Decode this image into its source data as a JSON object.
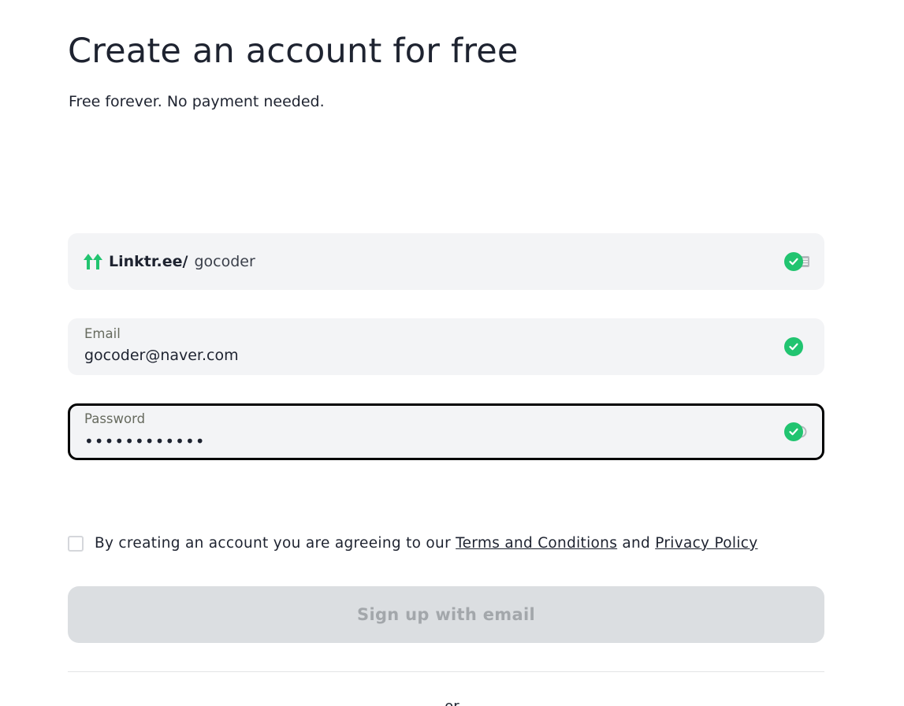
{
  "header": {
    "title": "Create an account for free",
    "subtitle": "Free forever. No payment needed."
  },
  "form": {
    "username": {
      "prefix": "Linktr.ee/",
      "value": "gocoder",
      "logo_icon": "linktree-logo-icon",
      "status_icon": "check-circle-icon"
    },
    "email": {
      "label": "Email",
      "value": "gocoder@naver.com",
      "status_icon": "check-circle-icon"
    },
    "password": {
      "label": "Password",
      "value": "••••••••••••",
      "status_icon": "check-circle-icon"
    },
    "terms": {
      "text_before": "By creating an account you are agreeing to our ",
      "terms_link": "Terms and Conditions",
      "text_between": " and ",
      "privacy_link": "Privacy Policy",
      "checked": false
    },
    "submit_label": "Sign up with email"
  },
  "footer": {
    "partial_text": "or"
  },
  "colors": {
    "accent_green": "#21c470",
    "field_bg": "#f3f4f6",
    "button_disabled_bg": "#dbdee1",
    "button_disabled_text": "#a3a7ab",
    "text": "#1e2330"
  }
}
